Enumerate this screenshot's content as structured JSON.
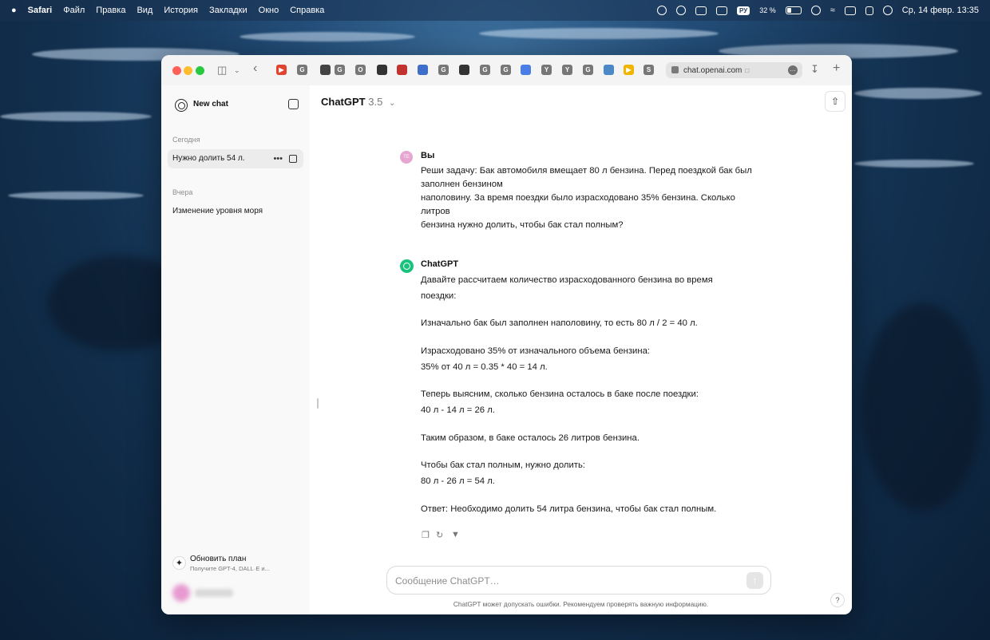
{
  "menubar": {
    "apple": "",
    "app": "Safari",
    "items": [
      "Файл",
      "Правка",
      "Вид",
      "История",
      "Закладки",
      "Окно",
      "Справка"
    ],
    "battery": "32 %",
    "input_lang": "РУ",
    "clock": "Ср, 14 февр.  13:35"
  },
  "browser": {
    "url": "chat.openai.com",
    "tab_favicons": [
      "G",
      "G",
      "O",
      "G",
      "G",
      "G",
      "G",
      "G",
      "Y",
      "Y",
      "G",
      "S"
    ]
  },
  "sidebar": {
    "new_chat": "New chat",
    "section_today": "Сегодня",
    "item_today": "Нужно долить 54 л.",
    "item_more": "•••",
    "section_yesterday": "Вчера",
    "item_yesterday": "Изменение уровня моря",
    "upgrade_title": "Обновить план",
    "upgrade_sub": "Получите GPT-4, DALL·E и..."
  },
  "main": {
    "model_name": "ChatGPT",
    "model_version": "3.5",
    "user": {
      "avatar": "TE",
      "author": "Вы",
      "lines": [
        "Реши задачу:  Бак автомобиля вмещает 80 л бензина. Перед поездкой бак был",
        "заполнен бензином",
        "наполовину. За время поездки было израсходовано 35% бензина. Сколько",
        "литров",
        "бензина нужно долить, чтобы бак стал полным?"
      ]
    },
    "assistant": {
      "author": "ChatGPT",
      "p1": "Давайте рассчитаем количество израсходованного бензина во время",
      "p1b": "поездки:",
      "p2": "Изначально бак был заполнен наполовину, то есть 80 л / 2 = 40 л.",
      "p3": "Израсходовано 35% от изначального объема бензина:",
      "p3b": "35% от 40 л = 0.35 * 40 = 14 л.",
      "p4": "Теперь выясним, сколько бензина осталось в баке после поездки:",
      "p4b": "40 л - 14 л = 26 л.",
      "p5": "Таким образом, в баке осталось 26 литров бензина.",
      "p6": "Чтобы бак стал полным, нужно долить:",
      "p6b": "80 л - 26 л = 54 л.",
      "p7": "Ответ: Необходимо долить 54 литра бензина, чтобы бак стал полным."
    },
    "composer_placeholder": "Сообщение ChatGPT…",
    "disclaimer": "ChatGPT может допускать ошибки. Рекомендуем проверять важную информацию.",
    "help": "?"
  }
}
